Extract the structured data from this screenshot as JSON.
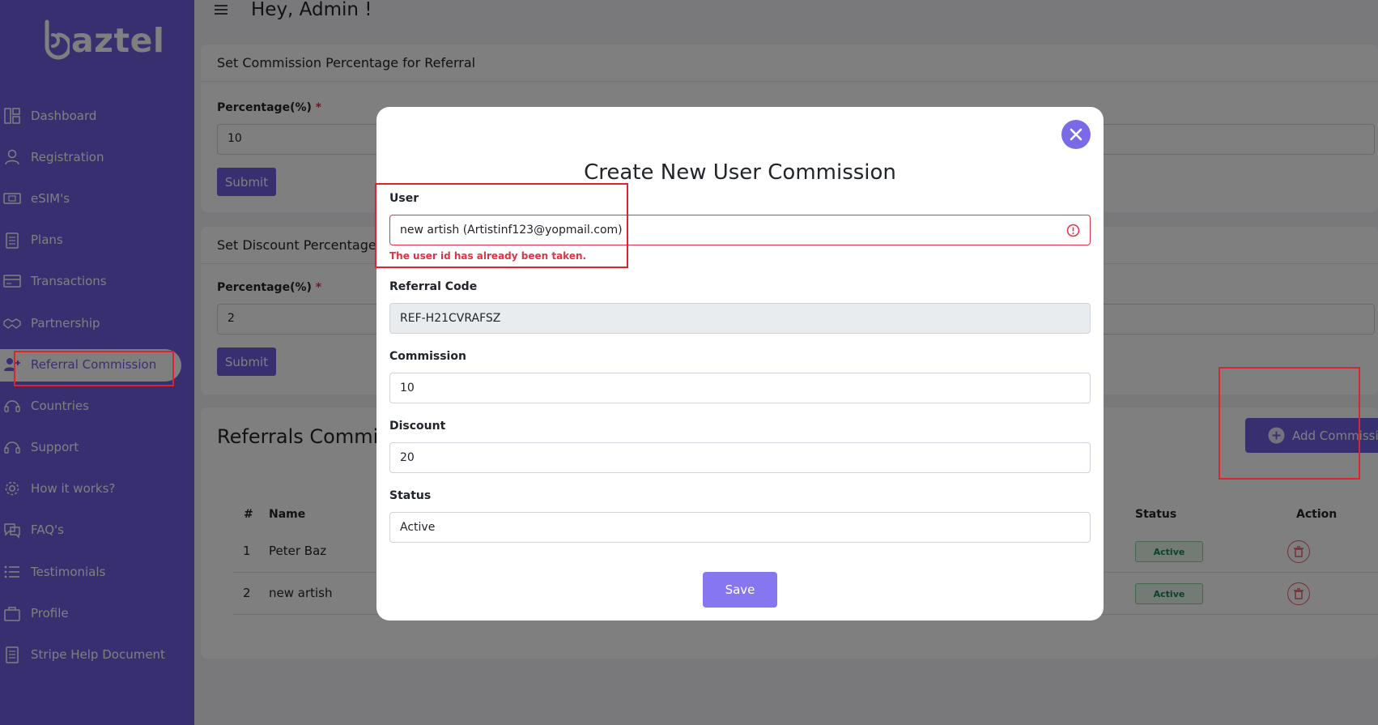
{
  "brand": {
    "logo_text": "aztel"
  },
  "sidebar": {
    "items": [
      {
        "label": "Dashboard",
        "icon": "dashboard-icon"
      },
      {
        "label": "Registration",
        "icon": "user-icon"
      },
      {
        "label": "eSIM's",
        "icon": "sim-card-icon"
      },
      {
        "label": "Plans",
        "icon": "clipboard-icon"
      },
      {
        "label": "Transactions",
        "icon": "card-icon"
      },
      {
        "label": "Partnership",
        "icon": "handshake-icon"
      },
      {
        "label": "Referral Commission",
        "icon": "user-plus-icon",
        "active": true
      },
      {
        "label": "Countries",
        "icon": "headset-icon"
      },
      {
        "label": "Support",
        "icon": "headset-icon"
      },
      {
        "label": "How it works?",
        "icon": "gear-icon"
      },
      {
        "label": "FAQ's",
        "icon": "faq-icon"
      },
      {
        "label": "Testimonials",
        "icon": "list-icon"
      },
      {
        "label": "Profile",
        "icon": "bag-icon"
      },
      {
        "label": "Stripe Help Document",
        "icon": "document-icon"
      }
    ]
  },
  "header": {
    "greeting": "Hey, Admin !"
  },
  "referral_card": {
    "title": "Set Commission Percentage for Referral",
    "label": "Percentage(%)",
    "required_mark": "*",
    "value": "10",
    "submit_label": "Submit"
  },
  "discount_card": {
    "title": "Set Discount Percentage fo",
    "label": "Percentage(%)",
    "required_mark": "*",
    "value": "2",
    "submit_label": "Submit"
  },
  "commissions": {
    "title": "Referrals Commiss",
    "add_label": "Add Commission",
    "columns": {
      "num": "#",
      "name": "Name",
      "status": "Status",
      "action": "Action"
    },
    "rows": [
      {
        "num": "1",
        "name": "Peter Baz",
        "status": "Active"
      },
      {
        "num": "2",
        "name": "new artish",
        "status": "Active"
      }
    ]
  },
  "modal": {
    "title": "Create New User Commission",
    "user_label": "User",
    "user_value": "new artish (Artistinf123@yopmail.com)",
    "user_error": "The user id has already been taken.",
    "referral_label": "Referral Code",
    "referral_value": "REF-H21CVRAFSZ",
    "commission_label": "Commission",
    "commission_value": "10",
    "discount_label": "Discount",
    "discount_value": "20",
    "status_label": "Status",
    "status_value": "Active",
    "save_label": "Save"
  },
  "colors": {
    "primary": "#6f5fe0",
    "error": "#dc3545",
    "success": "#198754",
    "annotation": "#e0232b"
  }
}
